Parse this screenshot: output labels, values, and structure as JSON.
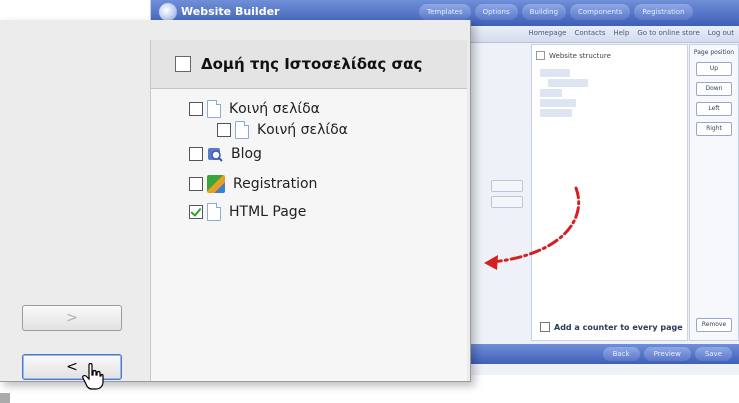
{
  "background_app": {
    "title": "Website Builder",
    "nav": [
      "Templates",
      "Options",
      "Building",
      "Components",
      "Registration"
    ],
    "toolbar": [
      "Homepage",
      "Contacts",
      "Help",
      "Go to online store",
      "Log out"
    ],
    "panel": {
      "header": "Website structure",
      "add_counter": "Add a counter to every page"
    },
    "side_buttons": [
      "Up",
      "Down",
      "Left",
      "Right"
    ],
    "side_label": "Page position",
    "remove_button": "Remove",
    "bottom_nav": [
      "Back",
      "Preview",
      "Save"
    ]
  },
  "dialog": {
    "header": "Δομή της Ιστοσελίδας σας",
    "items": [
      {
        "label": "Κοινή σελίδα",
        "icon": "page-icon",
        "checked": false
      },
      {
        "label": "Κοινή σελίδα",
        "icon": "page-icon",
        "checked": false
      },
      {
        "label": "Blog",
        "icon": "blog-icon",
        "checked": false
      },
      {
        "label": "Registration",
        "icon": "registration-icon",
        "checked": false
      },
      {
        "label": "HTML Page",
        "icon": "page-icon",
        "checked": true
      }
    ],
    "next_button": ">",
    "prev_button": "<"
  },
  "colors": {
    "accent": "#3f5fb8",
    "arrow": "#d42020",
    "check": "#2e9e2e"
  }
}
